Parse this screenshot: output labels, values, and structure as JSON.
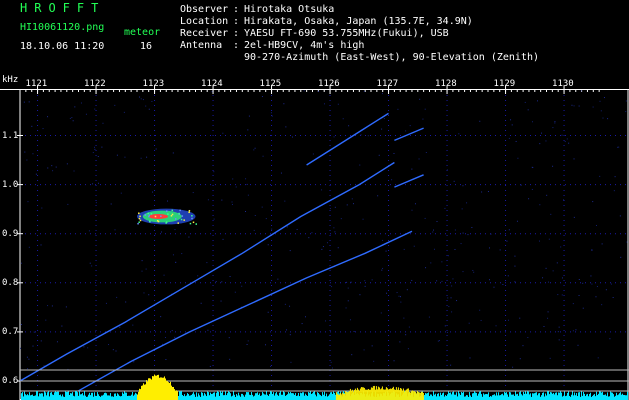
{
  "header": {
    "program": "HROFFT",
    "filename": "HI10061120.png",
    "meteor_label": "meteor",
    "datetime": "18.10.06 11:20",
    "meteor_count": "16",
    "observer_key": "Observer",
    "observer_val": "Hirotaka Otsuka",
    "location_key": "Location",
    "location_val": "Hirakata, Osaka, Japan (135.7E, 34.9N)",
    "receiver_key": "Receiver",
    "receiver_val": "YAESU FT-690 53.755MHz(Fukui), USB",
    "antenna_key": "Antenna",
    "antenna_val1": "2el-HB9CV, 4m's high",
    "antenna_val2": "90-270-Azimuth (East-West), 90-Elevation (Zenith)",
    "sep": ":"
  },
  "chart_data": {
    "type": "spectrogram",
    "ylabel": "kHz",
    "x_ticks": [
      "1121",
      "1122",
      "1123",
      "1124",
      "1125",
      "1126",
      "1127",
      "1128",
      "1129",
      "1130"
    ],
    "y_ticks": [
      "1.1",
      "1.0",
      "0.9",
      "0.8",
      "0.7",
      "0.6"
    ],
    "xlim": [
      1120.7,
      1130.6
    ],
    "ylim": [
      0.6,
      1.15
    ],
    "grid": true,
    "colors": {
      "trace": "#2f6bff",
      "grid": "#1a1aa6",
      "level": "#00e5ff",
      "burst": "#ffee00",
      "border": "#ffffff"
    },
    "traces": [
      {
        "points": [
          [
            1120.7,
            0.6
          ],
          [
            1121.5,
            0.655
          ],
          [
            1122.5,
            0.72
          ],
          [
            1123.5,
            0.79
          ],
          [
            1124.5,
            0.86
          ],
          [
            1125.5,
            0.935
          ],
          [
            1126.5,
            1.0
          ],
          [
            1127.1,
            1.045
          ]
        ]
      },
      {
        "points": [
          [
            1121.7,
            0.58
          ],
          [
            1122.6,
            0.64
          ],
          [
            1123.6,
            0.7
          ],
          [
            1124.6,
            0.755
          ],
          [
            1125.6,
            0.81
          ],
          [
            1126.6,
            0.86
          ],
          [
            1127.4,
            0.905
          ]
        ]
      },
      {
        "points": [
          [
            1125.6,
            1.04
          ],
          [
            1126.6,
            1.115
          ],
          [
            1127.0,
            1.145
          ]
        ]
      },
      {
        "points": [
          [
            1127.1,
            1.09
          ],
          [
            1127.6,
            1.115
          ]
        ]
      },
      {
        "points": [
          [
            1127.1,
            0.995
          ],
          [
            1127.6,
            1.02
          ]
        ]
      }
    ],
    "blob": {
      "x": [
        1122.7,
        1123.7
      ],
      "y": [
        0.925,
        0.945
      ]
    },
    "bursts": [
      {
        "x": [
          1122.7,
          1123.4
        ],
        "level": 1.0
      },
      {
        "x": [
          1126.1,
          1127.6
        ],
        "level": 0.35
      }
    ]
  }
}
